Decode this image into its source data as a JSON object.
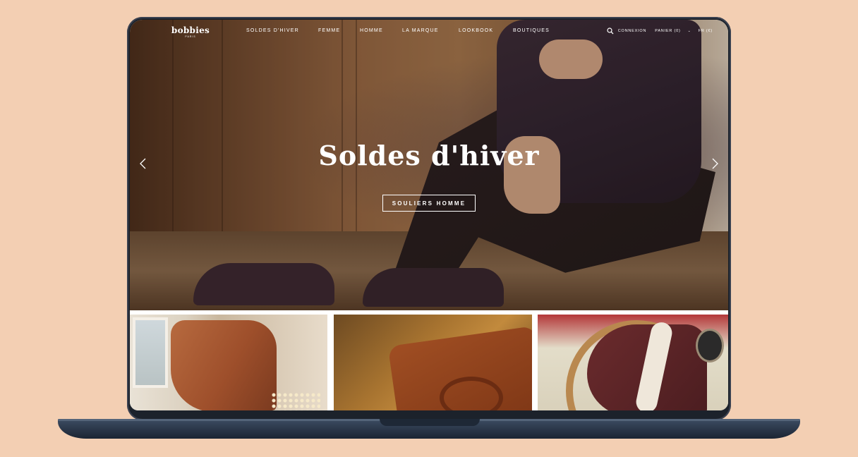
{
  "brand": {
    "name": "bobbies",
    "tagline": "PARIS"
  },
  "nav": {
    "items": [
      "SOLDES D'HIVER",
      "FEMME",
      "HOMME",
      "LA MARQUE",
      "LOOKBOOK",
      "BOUTIQUES"
    ],
    "connexion": "CONNEXION",
    "panier": "PANIER (0)",
    "language": "FR (€)",
    "icons": [
      "search-icon",
      "chevron-down-icon"
    ]
  },
  "hero": {
    "title": "Soldes d'hiver",
    "cta_label": "SOULIERS HOMME",
    "prev_icon": "chevron-left-icon",
    "next_icon": "chevron-right-icon"
  },
  "colors": {
    "background": "#f3cfb3",
    "laptop": "#1c222b",
    "text_on_image": "#ffffff"
  }
}
